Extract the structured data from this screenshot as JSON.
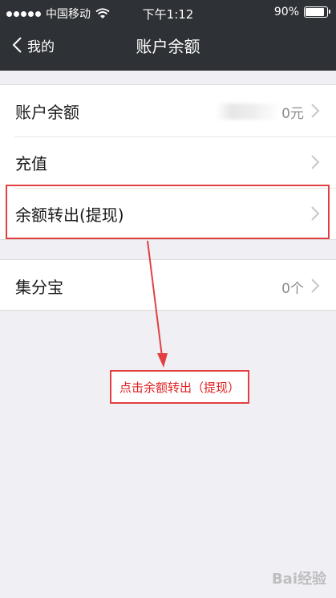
{
  "status_bar": {
    "carrier": "中国移动",
    "time": "下午1:12",
    "battery": "90%"
  },
  "nav": {
    "back_label": "我的",
    "title": "账户余额"
  },
  "group1": [
    {
      "label": "账户余额",
      "value": "0元"
    },
    {
      "label": "充值",
      "value": ""
    },
    {
      "label": "余额转出(提现)",
      "value": ""
    }
  ],
  "group2": [
    {
      "label": "集分宝",
      "value": "0个"
    }
  ],
  "annotation": {
    "text": "点击余额转出（提现）",
    "color": "#e02020"
  },
  "watermark": "Bai经验"
}
